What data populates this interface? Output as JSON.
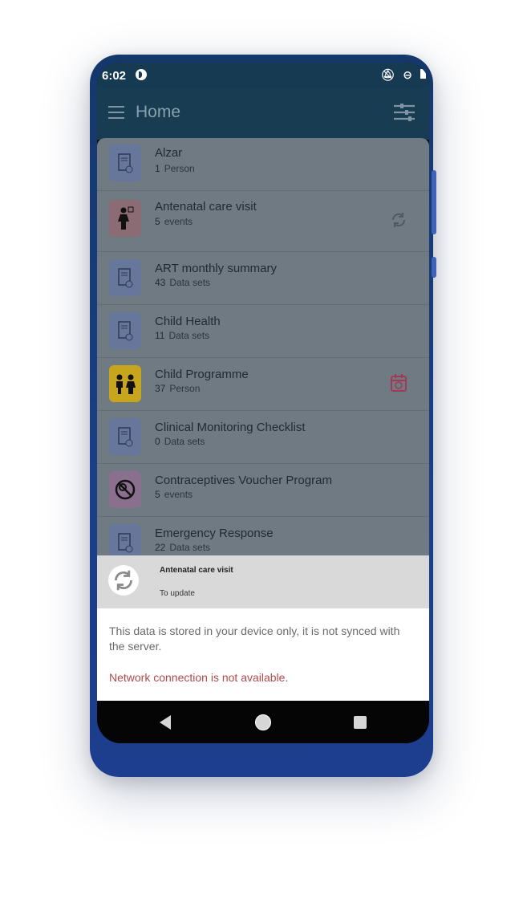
{
  "status_bar": {
    "time": "6:02"
  },
  "toolbar": {
    "title": "Home"
  },
  "programs": [
    {
      "name": "Alzar",
      "count": "1",
      "unit": "Person",
      "icon": "data-set-icon"
    },
    {
      "name": "Antenatal care visit",
      "count": "5",
      "unit": "events",
      "icon": "pregnant-woman-icon",
      "status": "sync-icon"
    },
    {
      "name": "ART monthly summary",
      "count": "43",
      "unit": "Data sets",
      "icon": "data-set-icon"
    },
    {
      "name": "Child Health",
      "count": "11",
      "unit": "Data sets",
      "icon": "data-set-icon"
    },
    {
      "name": "Child Programme",
      "count": "37",
      "unit": "Person",
      "icon": "children-icon",
      "status": "calendar-icon"
    },
    {
      "name": "Clinical Monitoring Checklist",
      "count": "0",
      "unit": "Data sets",
      "icon": "data-set-icon"
    },
    {
      "name": "Contraceptives Voucher Program",
      "count": "5",
      "unit": "events",
      "icon": "no-contraceptive-icon"
    },
    {
      "name": "Emergency Response",
      "count": "22",
      "unit": "Data sets",
      "icon": "data-set-icon"
    }
  ],
  "sync_dialog": {
    "program": "Antenatal care visit",
    "state": "To update",
    "message": "This data is stored in your device only, it is not synced with the server.",
    "error": "Network connection is not available."
  },
  "colors": {
    "toolbar": "#183c52",
    "error_text": "#b04a4a",
    "calendar_accent": "#a33a55"
  }
}
